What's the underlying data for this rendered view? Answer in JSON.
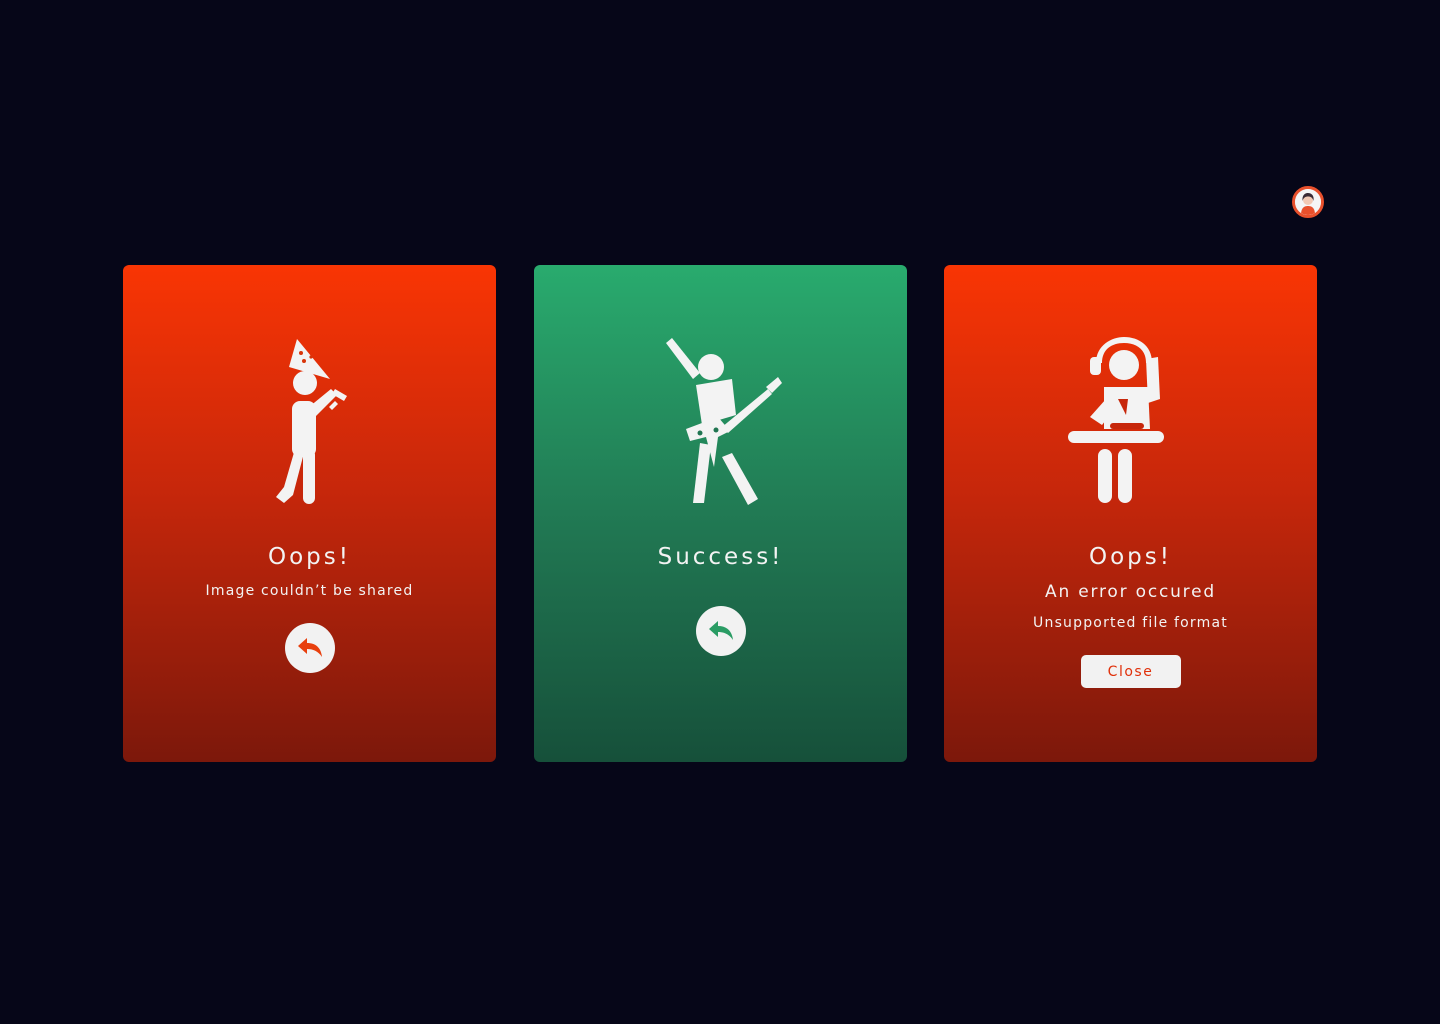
{
  "user": {
    "avatar_icon": "user-avatar-icon"
  },
  "colors": {
    "background": "#060618",
    "error_top": "#f93504",
    "error_bottom": "#7c180b",
    "success_top": "#29ab6e",
    "success_bottom": "#16503a",
    "error_accent": "#e8400e",
    "success_accent": "#2a9c64",
    "foreground": "#f3f3f3"
  },
  "cards": {
    "share_error": {
      "illustration_icon": "party-hat-figure-icon",
      "title": "Oops!",
      "message": "Image couldn’t be shared",
      "action_icon": "reply-arrow-icon"
    },
    "success": {
      "illustration_icon": "guitarist-figure-icon",
      "title": "Success!",
      "action_icon": "reply-arrow-icon"
    },
    "format_error": {
      "illustration_icon": "dj-figure-icon",
      "title": "Oops!",
      "message": "An error occured",
      "detail": "Unsupported file format",
      "close_label": "Close"
    }
  }
}
